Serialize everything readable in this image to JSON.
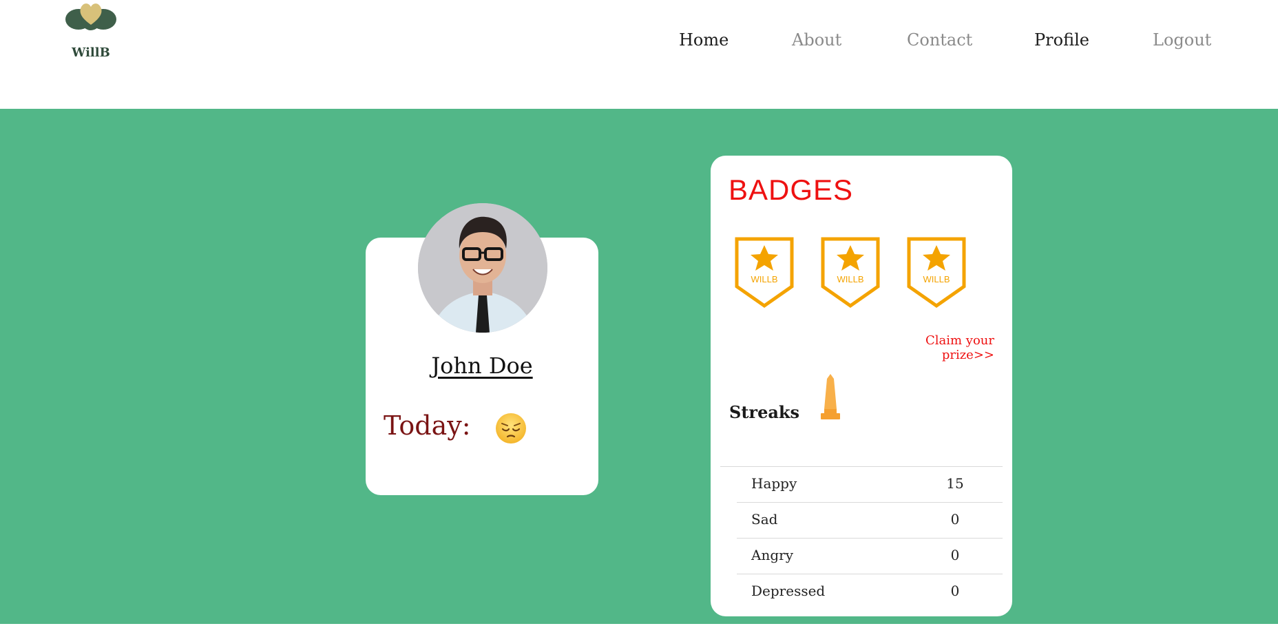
{
  "brand": {
    "name": "WillB"
  },
  "nav": {
    "items": [
      {
        "label": "Home",
        "state": "active"
      },
      {
        "label": "About",
        "state": "muted"
      },
      {
        "label": "Contact",
        "state": "muted"
      },
      {
        "label": "Profile",
        "state": "active"
      },
      {
        "label": "Logout",
        "state": "muted"
      }
    ]
  },
  "colors": {
    "main_bg": "#52b788",
    "badge_gold": "#f4a300",
    "title_red": "#ee1111",
    "today_maroon": "#7a1414"
  },
  "profile": {
    "name": "John Doe",
    "today_label": "Today:",
    "today_mood_icon": "pensive-face-emoji",
    "avatar_icon": "user-avatar-photo"
  },
  "badges": {
    "title": "BADGES",
    "items": [
      {
        "label": "WILLB",
        "icon": "star-badge-icon"
      },
      {
        "label": "WILLB",
        "icon": "star-badge-icon"
      },
      {
        "label": "WILLB",
        "icon": "star-badge-icon"
      }
    ],
    "claim_link": "Claim your prize>>",
    "streaks_label": "Streaks",
    "streaks_icon": "trophy-icon"
  },
  "stats": [
    {
      "label": "Happy",
      "value": "15"
    },
    {
      "label": "Sad",
      "value": "0"
    },
    {
      "label": "Angry",
      "value": "0"
    },
    {
      "label": "Depressed",
      "value": "0"
    }
  ]
}
